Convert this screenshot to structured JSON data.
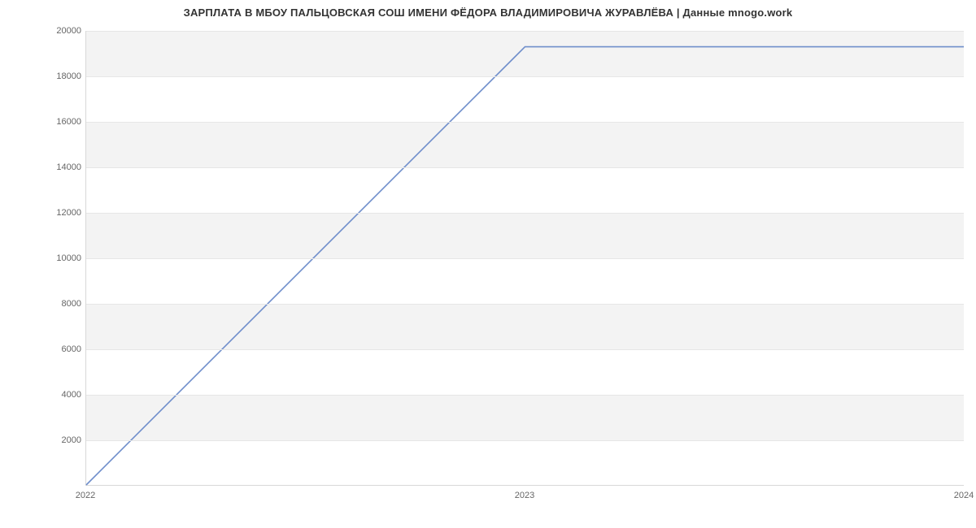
{
  "chart_data": {
    "type": "line",
    "title": "ЗАРПЛАТА В МБОУ ПАЛЬЦОВСКАЯ СОШ ИМЕНИ ФЁДОРА ВЛАДИМИРОВИЧА ЖУРАВЛЁВА | Данные mnogo.work",
    "xlabel": "",
    "ylabel": "",
    "x": [
      2022,
      2023,
      2024
    ],
    "values": [
      0,
      19300,
      19300
    ],
    "xlim": [
      2022,
      2024
    ],
    "ylim": [
      0,
      20000
    ],
    "yticks": [
      2000,
      4000,
      6000,
      8000,
      10000,
      12000,
      14000,
      16000,
      18000,
      20000
    ],
    "xticks": [
      2022,
      2023,
      2024
    ],
    "line_color": "#6f8ecb"
  }
}
